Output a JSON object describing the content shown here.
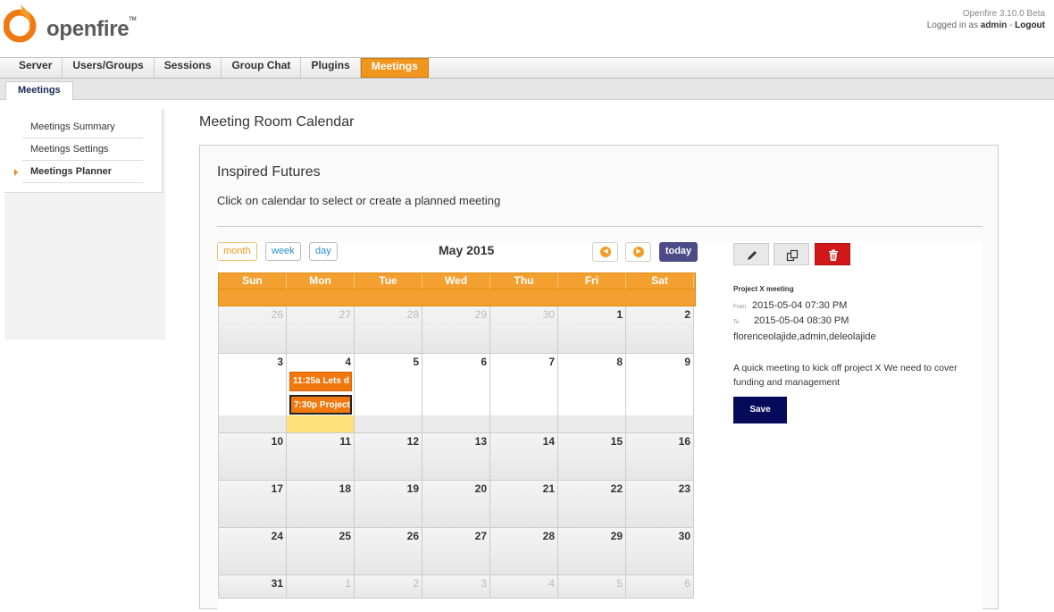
{
  "header": {
    "logo_text": "openfire",
    "logo_tm": "TM",
    "version": "Openfire 3.10.0 Beta",
    "logged_in_prefix": "Logged in as",
    "user": "admin",
    "separator": "-",
    "logout": "Logout"
  },
  "main_tabs": [
    {
      "label": "Server"
    },
    {
      "label": "Users/Groups"
    },
    {
      "label": "Sessions"
    },
    {
      "label": "Group Chat"
    },
    {
      "label": "Plugins"
    },
    {
      "label": "Meetings",
      "active": true
    }
  ],
  "sub_tabs": [
    {
      "label": "Meetings",
      "active": true
    }
  ],
  "sidebar": {
    "items": [
      {
        "label": "Meetings Summary"
      },
      {
        "label": "Meetings Settings"
      },
      {
        "label": "Meetings Planner",
        "active": true
      }
    ]
  },
  "page_title": "Meeting Room Calendar",
  "panel": {
    "title": "Inspired Futures",
    "hint": "Click on calendar to select or create a planned meeting"
  },
  "calendar": {
    "view_buttons": {
      "month": "month",
      "week": "week",
      "day": "day"
    },
    "title": "May 2015",
    "today_label": "today",
    "day_headers": [
      "Sun",
      "Mon",
      "Tue",
      "Wed",
      "Thu",
      "Fri",
      "Sat"
    ],
    "weeks": [
      [
        "26",
        "27",
        "28",
        "29",
        "30",
        "1",
        "2"
      ],
      [
        "3",
        "4",
        "5",
        "6",
        "7",
        "8",
        "9"
      ],
      [
        "10",
        "11",
        "12",
        "13",
        "14",
        "15",
        "16"
      ],
      [
        "17",
        "18",
        "19",
        "20",
        "21",
        "22",
        "23"
      ],
      [
        "24",
        "25",
        "26",
        "27",
        "28",
        "29",
        "30"
      ],
      [
        "31",
        "1",
        "2",
        "3",
        "4",
        "5",
        "6"
      ]
    ],
    "events": [
      {
        "label": "11:25a Lets d"
      },
      {
        "label": "7:30p Project"
      }
    ]
  },
  "details": {
    "title": "Project X meeting",
    "from_label": "From",
    "from_value": "2015-05-04  07:30 PM",
    "to_label": "To",
    "to_value": "2015-05-04  08:30 PM",
    "attendees": "florenceolajide,admin,deleolajide",
    "description": "A quick meeting to kick off project X We need to cover funding and management",
    "save_label": "Save"
  },
  "colors": {
    "accent": "#f0961e",
    "event": "#f0780f",
    "today_button": "#4b4b87",
    "delete_button": "#d01818",
    "save_button": "#050a5a",
    "today_highlight": "#ffe07a"
  },
  "icons": {
    "logo": "openfire-flame-icon",
    "prev": "chevron-left-icon",
    "next": "chevron-right-icon",
    "edit": "pencil-icon",
    "copy": "copy-icon",
    "delete": "trash-icon"
  }
}
